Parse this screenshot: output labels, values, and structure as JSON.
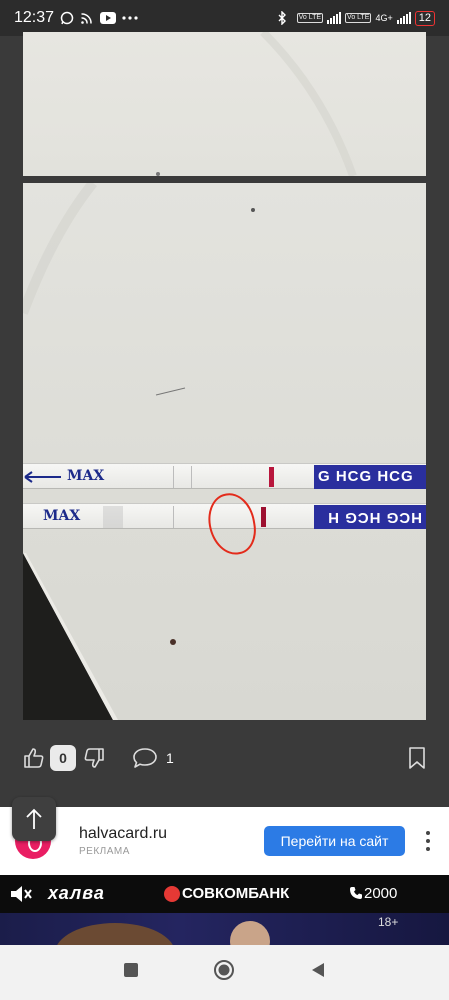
{
  "status_bar": {
    "time": "12:37",
    "network_type": "4G+",
    "volte_1": "Vo LTE",
    "volte_2": "Vo LTE",
    "battery": "12",
    "icons": [
      "whatsapp-icon",
      "cast-icon",
      "youtube-icon",
      "more-dots-icon",
      "bluetooth-icon",
      "signal-icon",
      "battery-icon"
    ]
  },
  "photo": {
    "strip_max_label": "MAX",
    "strip_text": "G HCG HCG",
    "strip_text_2": "HCG HCG H"
  },
  "actions": {
    "like_count": "0",
    "comment_count": "1"
  },
  "ad": {
    "site": "halvacard.ru",
    "label": "РЕКЛАМА",
    "cta": "Перейти на сайт",
    "banner_brand": "халва",
    "banner_bank": "СОВКОМБАНК",
    "banner_phone": "2000",
    "age_rating": "18+"
  },
  "colors": {
    "accent": "#2c7be5",
    "background": "#3a3a3a",
    "annotation": "#e32b1b",
    "strip_label": "#2a2f9e"
  }
}
